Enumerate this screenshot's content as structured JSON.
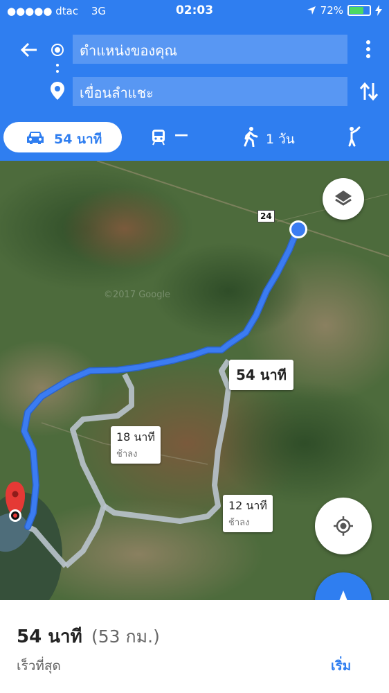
{
  "status_bar": {
    "carrier": "●●●●● dtac",
    "network": "3G",
    "time": "02:03",
    "battery": "72%"
  },
  "directions": {
    "origin": "ตำแหน่งของคุณ",
    "destination": "เขื่อนลำแชะ"
  },
  "modes": {
    "drive": "54 นาที",
    "transit": "—",
    "walk": "1 วัน"
  },
  "map": {
    "road_shield": "24",
    "watermark": "©2017 Google",
    "routes": [
      {
        "time": "54 นาที",
        "note": ""
      },
      {
        "time": "18 นาที",
        "note": "ช้าลง"
      },
      {
        "time": "12 นาที",
        "note": "ช้าลง"
      }
    ]
  },
  "summary": {
    "time": "54 นาที",
    "distance": "(53 กม.)",
    "note": "เร็วที่สุด",
    "start": "เริ่ม"
  },
  "colors": {
    "brand": "#2f7ef0",
    "route_primary": "#3b7cf2",
    "route_alt": "#b9c3cc",
    "battery": "#4cd964",
    "pin": "#e53935"
  },
  "icons": [
    "back-arrow-icon",
    "origin-icon",
    "destination-pin-icon",
    "more-icon",
    "swap-icon",
    "car-icon",
    "train-icon",
    "walk-icon",
    "ride-icon",
    "layers-icon",
    "my-location-icon",
    "navigation-icon",
    "location-arrow-icon",
    "charging-icon"
  ]
}
